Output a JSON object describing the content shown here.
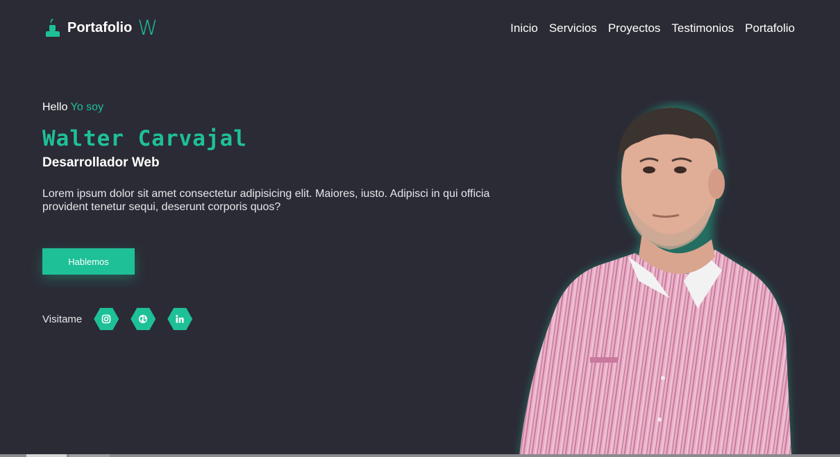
{
  "header": {
    "logo_text": "Portafolio",
    "logo_letter": "W",
    "nav": [
      "Inicio",
      "Servicios",
      "Proyectos",
      "Testimonios",
      "Portafolio"
    ]
  },
  "hero": {
    "greeting": "Hello",
    "greeting_accent": "Yo soy",
    "name": "Walter Carvajal",
    "role": "Desarrollador Web",
    "description": "Lorem ipsum dolor sit amet consectetur adipisicing elit. Maiores, iusto. Adipisci in qui officia provident tenetur sequi, deserunt corporis quos?",
    "cta_label": "Hablemos",
    "social_label": "Visitame",
    "social_icons": [
      "instagram-icon",
      "globe-icon",
      "linkedin-icon"
    ]
  },
  "colors": {
    "background": "#2b2b35",
    "accent": "#1ec097",
    "text": "#ffffff"
  }
}
